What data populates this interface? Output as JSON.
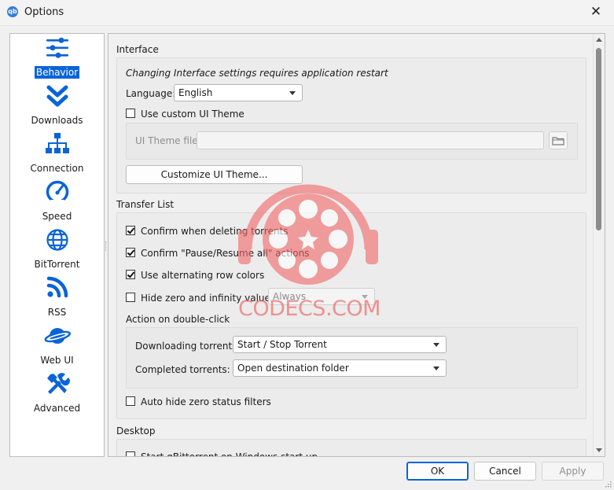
{
  "window": {
    "title": "Options",
    "app_icon_label": "qb",
    "close_glyph": "✕"
  },
  "sidebar": {
    "items": [
      {
        "label": "Behavior",
        "icon": "sliders-icon"
      },
      {
        "label": "Downloads",
        "icon": "double-chevron-down-icon"
      },
      {
        "label": "Connection",
        "icon": "network-icon"
      },
      {
        "label": "Speed",
        "icon": "speedometer-icon"
      },
      {
        "label": "BitTorrent",
        "icon": "globe-icon"
      },
      {
        "label": "RSS",
        "icon": "rss-icon"
      },
      {
        "label": "Web UI",
        "icon": "planet-icon"
      },
      {
        "label": "Advanced",
        "icon": "tools-icon"
      }
    ],
    "selected": "Behavior"
  },
  "interface": {
    "title": "Interface",
    "note": "Changing Interface settings requires application restart",
    "language_label": "Language:",
    "language_value": "English",
    "custom_theme_label": "Use custom UI Theme",
    "custom_theme_checked": false,
    "theme_file_label": "UI Theme file:",
    "theme_file_value": "",
    "customize_button": "Customize UI Theme..."
  },
  "transfer_list": {
    "title": "Transfer List",
    "options": [
      {
        "label": "Confirm when deleting torrents",
        "checked": true
      },
      {
        "label": "Confirm \"Pause/Resume all\" actions",
        "checked": true
      },
      {
        "label": "Use alternating row colors",
        "checked": true
      }
    ],
    "hide_zero_label": "Hide zero and infinity values",
    "hide_zero_checked": false,
    "hide_zero_combo": "Always",
    "double_click_title": "Action on double-click",
    "downloading_label": "Downloading torrents:",
    "downloading_value": "Start / Stop Torrent",
    "completed_label": "Completed torrents:",
    "completed_value": "Open destination folder",
    "auto_hide_label": "Auto hide zero status filters",
    "auto_hide_checked": false
  },
  "desktop": {
    "title": "Desktop",
    "startup_label": "Start qBittorrent on Windows start up"
  },
  "buttons": {
    "ok": "OK",
    "cancel": "Cancel",
    "apply": "Apply"
  },
  "watermark": {
    "text": "CODECS.COM"
  },
  "colors": {
    "accent": "#0a64d8",
    "icon_blue": "#0a64d8",
    "watermark": "#f16a6a"
  }
}
